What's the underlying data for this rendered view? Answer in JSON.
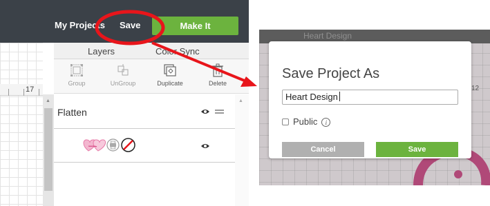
{
  "left_panel": {
    "topbar": {
      "projects_label": "My Projects",
      "save_label": "Save",
      "make_it_label": "Make It"
    },
    "ruler": {
      "number": "17"
    },
    "tabs": [
      {
        "label": "Layers"
      },
      {
        "label": "Color Sync"
      }
    ],
    "tools": [
      {
        "label": "Group",
        "icon": "group-icon",
        "enabled": false
      },
      {
        "label": "UnGroup",
        "icon": "ungroup-icon",
        "enabled": false
      },
      {
        "label": "Duplicate",
        "icon": "duplicate-icon",
        "enabled": true
      },
      {
        "label": "Delete",
        "icon": "trash-icon",
        "enabled": true
      }
    ],
    "layers": [
      {
        "label": "Flatten",
        "visible": true
      },
      {
        "label": "",
        "visible": true,
        "icons": [
          "hearts-thumbnail-icon",
          "print-icon",
          "no-fill-icon"
        ]
      }
    ]
  },
  "annotation": {
    "color": "#e8151b"
  },
  "dialog_view": {
    "background_title": "Heart Design",
    "ruler_number": "12",
    "dialog": {
      "title": "Save Project As",
      "input_value": "Heart Design",
      "public_label": "Public",
      "public_checked": false,
      "cancel_label": "Cancel",
      "save_label": "Save"
    }
  },
  "colors": {
    "topbar": "#3b4148",
    "accent_green": "#6cb33e",
    "cancel_gray": "#b0b0b0"
  }
}
